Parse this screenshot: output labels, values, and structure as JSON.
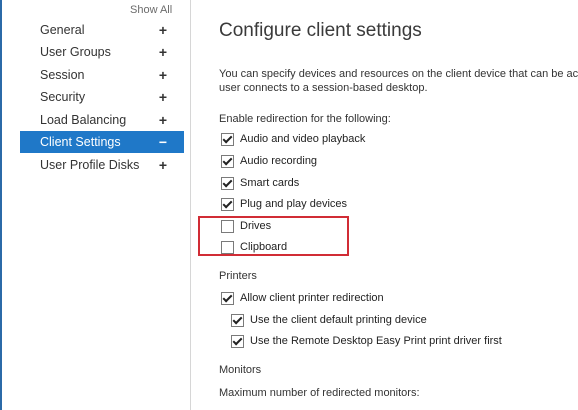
{
  "sidebar": {
    "show_all": "Show All",
    "items": [
      {
        "label": "General",
        "toggle": "+"
      },
      {
        "label": "User Groups",
        "toggle": "+"
      },
      {
        "label": "Session",
        "toggle": "+"
      },
      {
        "label": "Security",
        "toggle": "+"
      },
      {
        "label": "Load Balancing",
        "toggle": "+"
      },
      {
        "label": "Client Settings",
        "toggle": "−"
      },
      {
        "label": "User Profile Disks",
        "toggle": "+"
      }
    ]
  },
  "main": {
    "title": "Configure client settings",
    "description_line1": "You can specify devices and resources on the client device that can be ac",
    "description_line2": "user connects to a session-based desktop.",
    "redirection_heading": "Enable redirection for the following:",
    "redirection": [
      {
        "label": "Audio and video playback",
        "checked": true
      },
      {
        "label": "Audio recording",
        "checked": true
      },
      {
        "label": "Smart cards",
        "checked": true
      },
      {
        "label": "Plug and play devices",
        "checked": true
      },
      {
        "label": "Drives",
        "checked": false
      },
      {
        "label": "Clipboard",
        "checked": false
      }
    ],
    "printers_heading": "Printers",
    "printers": [
      {
        "label": "Allow client printer redirection",
        "checked": true
      },
      {
        "label": "Use the client default printing device",
        "checked": true
      },
      {
        "label": "Use the Remote Desktop Easy Print print driver first",
        "checked": true
      }
    ],
    "monitors_heading": "Monitors",
    "monitors_label": "Maximum number of redirected monitors:"
  },
  "colors": {
    "accent": "#1f78c8",
    "highlight": "#d12c35"
  }
}
